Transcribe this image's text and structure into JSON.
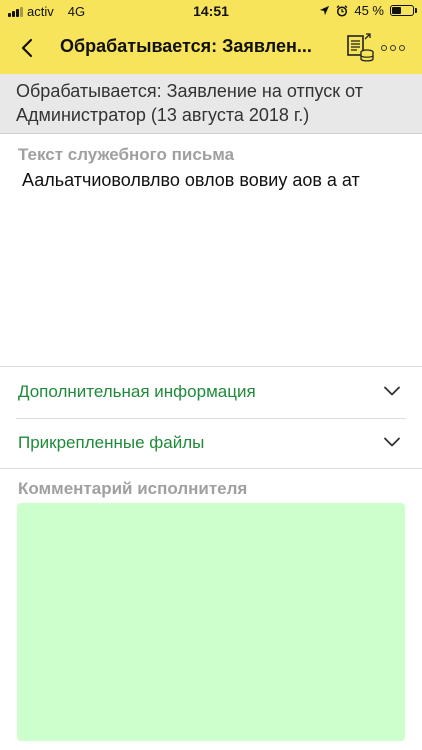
{
  "status_bar": {
    "carrier": "activ",
    "network": "4G",
    "time": "14:51",
    "battery_percent": "45 %",
    "battery_level": 0.45
  },
  "navbar": {
    "title": "Обрабатывается: Заявлен..."
  },
  "document": {
    "header_line1": "Обрабатывается: Заявление на отпуск от",
    "header_line2": "Администратор (13 августа 2018 г.)"
  },
  "letter": {
    "label": "Текст служебного письма",
    "text": "Аальатчиоволвлво овлов вовиу аов а ат"
  },
  "sections": {
    "additional_info": "Дополнительная информация",
    "attached_files": "Прикрепленные файлы"
  },
  "comment": {
    "label": "Комментарий исполнителя",
    "value": ""
  },
  "colors": {
    "header_yellow": "#f7e45a",
    "link_green": "#1f8a3a",
    "comment_bg": "#ccffcc"
  },
  "icons": [
    "chevron-left-icon",
    "document-stack-icon",
    "more-dots-icon",
    "chevron-down-icon",
    "location-arrow-icon",
    "alarm-icon",
    "battery-icon",
    "signal-icon"
  ]
}
